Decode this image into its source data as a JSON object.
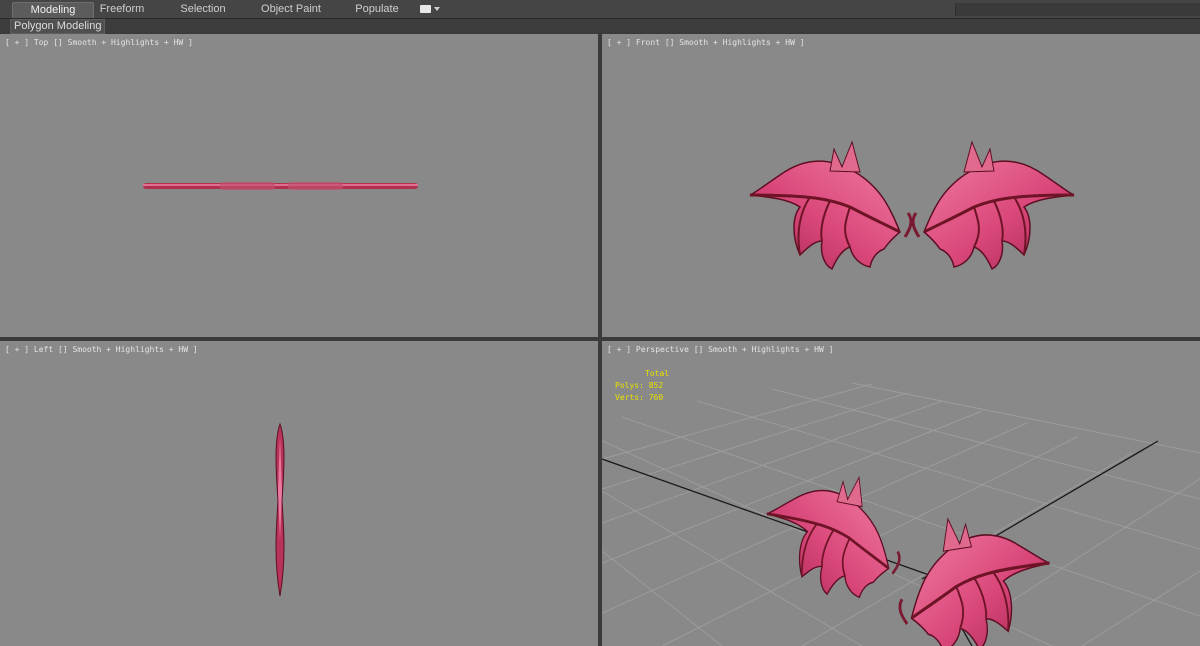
{
  "ribbon": {
    "tabs": [
      {
        "label": "Modeling",
        "active": true
      },
      {
        "label": "Freeform",
        "active": false
      },
      {
        "label": "Selection",
        "active": false
      },
      {
        "label": "Object Paint",
        "active": false
      },
      {
        "label": "Populate",
        "active": false
      }
    ],
    "panel_label": "Polygon Modeling",
    "dropdown_icon": "ribbon-options-icon"
  },
  "viewports": [
    {
      "id": "top",
      "open": "[ + ]",
      "view": "Top",
      "shading": "Smooth + Highlights",
      "extra": "+ HW",
      "close": "]"
    },
    {
      "id": "front",
      "open": "[ + ]",
      "view": "Front",
      "shading": "Smooth + Highlights",
      "extra": "+ HW",
      "close": "]"
    },
    {
      "id": "left",
      "open": "[ + ]",
      "view": "Left",
      "shading": "Smooth + Highlights",
      "extra": "+ HW",
      "close": "]"
    },
    {
      "id": "perspective",
      "open": "[ + ]",
      "view": "Perspective",
      "shading": "Smooth + Highlights",
      "extra": "+ HW",
      "close": "]"
    }
  ],
  "stats": {
    "header": "Total",
    "polys_label": "Polys:",
    "polys_value": "852",
    "verts_label": "Verts:",
    "verts_value": "760"
  },
  "colors": {
    "viewport_bg": "#898989",
    "stats_text": "#e8e000",
    "wing_membrane": "#e0557f",
    "wing_bone": "#6e1426"
  }
}
